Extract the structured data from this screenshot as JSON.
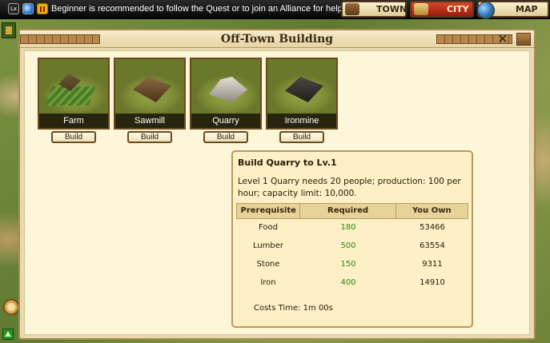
{
  "topbar": {
    "lx_label": "Lx",
    "message": "Beginner is recommended to follow the Quest or to join an Alliance for help",
    "nav": {
      "town": "TOWN",
      "city": "CITY",
      "map": "MAP"
    }
  },
  "dialog": {
    "title": "Off-Town Building",
    "close_label": "✕",
    "buildings": [
      {
        "name": "Farm",
        "build_label": "Build"
      },
      {
        "name": "Sawmill",
        "build_label": "Build"
      },
      {
        "name": "Quarry",
        "build_label": "Build"
      },
      {
        "name": "Ironmine",
        "build_label": "Build"
      }
    ],
    "info": {
      "title": "Build Quarry to Lv.1",
      "description": "Level 1 Quarry needs 20 people; production: 100 per hour; capacity limit: 10,000.",
      "headers": {
        "prerequisite": "Prerequisite",
        "required": "Required",
        "you_own": "You Own"
      },
      "rows": [
        {
          "name": "Food",
          "required": "180",
          "own": "53466"
        },
        {
          "name": "Lumber",
          "required": "500",
          "own": "63554"
        },
        {
          "name": "Stone",
          "required": "150",
          "own": "9311"
        },
        {
          "name": "Iron",
          "required": "400",
          "own": "14910"
        }
      ],
      "cost_label": "Costs Time:",
      "cost_value": "1m 00s"
    }
  }
}
